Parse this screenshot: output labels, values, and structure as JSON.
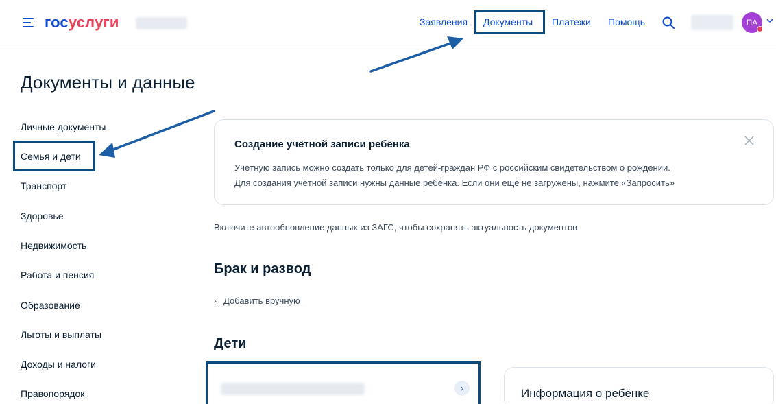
{
  "header": {
    "logo_gos": "гос",
    "logo_uslugi": "услуги",
    "nav": {
      "applications": "Заявления",
      "documents": "Документы",
      "payments": "Платежи",
      "help": "Помощь"
    },
    "avatar_initials": "ПА"
  },
  "page": {
    "title": "Документы и данные"
  },
  "sidebar": {
    "items": [
      {
        "label": "Личные документы"
      },
      {
        "label": "Семья и дети"
      },
      {
        "label": "Транспорт"
      },
      {
        "label": "Здоровье"
      },
      {
        "label": "Недвижимость"
      },
      {
        "label": "Работа и пенсия"
      },
      {
        "label": "Образование"
      },
      {
        "label": "Льготы и выплаты"
      },
      {
        "label": "Доходы и налоги"
      },
      {
        "label": "Правопорядок"
      }
    ]
  },
  "notice": {
    "title": "Создание учётной записи ребёнка",
    "line1": "Учётную запись можно создать только для детей-граждан РФ с российским свидетельством о рождении.",
    "line2": "Для создания учётной записи нужны данные ребёнка. Если они ещё не загружены, нажмите «Запросить»"
  },
  "autoupdate_text": "Включите автообновление данных из ЗАГС, чтобы сохранять актуальность документов",
  "sections": {
    "marriage_title": "Брак и развод",
    "add_manually": "Добавить вручную",
    "children_title": "Дети",
    "child_info_title": "Информация о ребёнке"
  },
  "colors": {
    "accent": "#0d4cd3",
    "logo_red": "#ee3f58",
    "annotation": "#0c4b7d",
    "avatar": "#a43fd6"
  },
  "icons": {
    "menu": "burger-menu-icon",
    "search": "search-icon",
    "close": "close-icon",
    "chevron": "chevron-down-icon",
    "arrow": "chevron-right-icon"
  }
}
